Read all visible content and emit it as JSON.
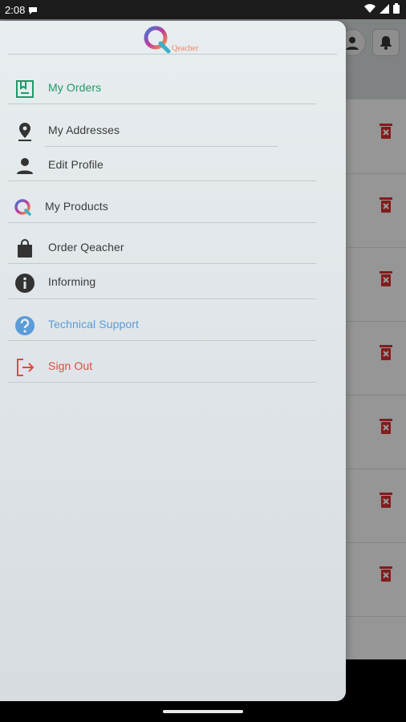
{
  "status_bar": {
    "time": "2:08"
  },
  "brand": {
    "name": "Qeacher"
  },
  "drawer": {
    "items": [
      {
        "label": "My Orders",
        "icon": "orders-icon"
      },
      {
        "label": "My Addresses",
        "icon": "location-pin-icon"
      },
      {
        "label": "Edit Profile",
        "icon": "person-icon"
      },
      {
        "label": "My Products",
        "icon": "q-logo-icon"
      },
      {
        "label": "Order Qeacher",
        "icon": "shopping-bag-icon"
      },
      {
        "label": "Informing",
        "icon": "info-icon"
      },
      {
        "label": "Technical Support",
        "icon": "help-icon"
      },
      {
        "label": "Sign Out",
        "icon": "sign-out-icon"
      }
    ]
  },
  "colors": {
    "accent_green": "#1d9a66",
    "support_blue": "#5b9cd8",
    "signout_red": "#e04a40",
    "logo_orange": "#f0825e"
  }
}
